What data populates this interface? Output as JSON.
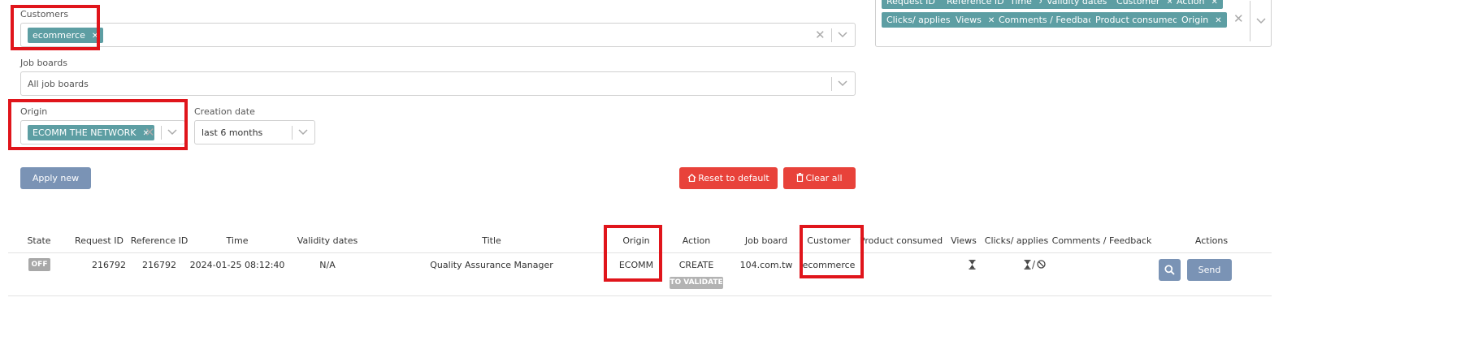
{
  "filters": {
    "customers": {
      "label": "Customers",
      "chips": [
        {
          "text": "ecommerce"
        }
      ]
    },
    "job_boards": {
      "label": "Job boards",
      "value": "All job boards"
    },
    "origin": {
      "label": "Origin",
      "chips": [
        {
          "text": "ECOMM THE NETWORK"
        }
      ]
    },
    "creation_date": {
      "label": "Creation date",
      "value": "last 6 months"
    }
  },
  "columns_selector": {
    "row1": [
      "Request ID",
      "Reference ID",
      "Time",
      "Validity dates",
      "Customer",
      "Action"
    ],
    "row2": [
      "Clicks/ applies",
      "Views",
      "Comments / Feedback",
      "Product consumed",
      "Origin"
    ]
  },
  "buttons": {
    "apply": "Apply new filters",
    "reset": "Reset to default filters",
    "clear": "Clear all filters",
    "send": "Send"
  },
  "table": {
    "headers": [
      "State",
      "Request ID",
      "Reference ID",
      "Time",
      "Validity dates",
      "Title",
      "Origin",
      "Action",
      "Job board",
      "Customer",
      "Product consumed",
      "Views",
      "Clicks/ applies",
      "Comments / Feedback",
      "Actions"
    ],
    "rows": [
      {
        "state": "OFF",
        "request_id": "216792",
        "reference_id": "216792",
        "time": "2024-01-25 08:12:40",
        "validity_dates": "N/A",
        "title": "Quality Assurance Manager",
        "origin": "ECOMM",
        "action": "CREATE",
        "action_badge": "TO VALIDATE",
        "job_board": "104.com.tw",
        "customer": "ecommerce",
        "clicks_separator": "/"
      }
    ]
  },
  "colors": {
    "chip": "#5d9ea3",
    "apply_button": "#7a93b5",
    "danger": "#e8423a",
    "highlight": "#e0151b",
    "state_off": "#a8a8a8"
  }
}
